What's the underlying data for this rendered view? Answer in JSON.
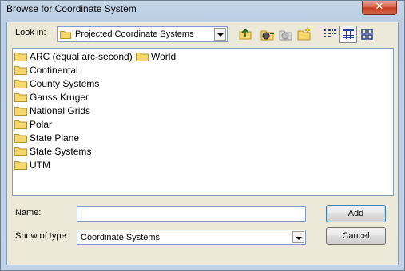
{
  "window": {
    "title": "Browse for Coordinate System",
    "close_glyph": "✕"
  },
  "lookin": {
    "label": "Look in:",
    "value": "Projected Coordinate Systems"
  },
  "toolbar": {
    "icons": [
      "up-one-level-icon",
      "connect-folder-icon",
      "disconnect-folder-icon",
      "new-folder-icon",
      "list-view-icon",
      "details-view-icon",
      "large-icons-view-icon"
    ]
  },
  "folders": [
    {
      "name": "ARC (equal arc-second)"
    },
    {
      "name": "World"
    },
    {
      "name": "Continental"
    },
    {
      "name": "County Systems"
    },
    {
      "name": "Gauss Kruger"
    },
    {
      "name": "National Grids"
    },
    {
      "name": "Polar"
    },
    {
      "name": "State Plane"
    },
    {
      "name": "State Systems"
    },
    {
      "name": "UTM"
    }
  ],
  "name_field": {
    "label": "Name:",
    "value": ""
  },
  "type_field": {
    "label": "Show of type:",
    "value": "Coordinate Systems"
  },
  "buttons": {
    "add": "Add",
    "cancel": "Cancel"
  },
  "colors": {
    "folder": "#f5d76e",
    "folder_edge": "#b8952a",
    "accent": "#7f9db9"
  }
}
